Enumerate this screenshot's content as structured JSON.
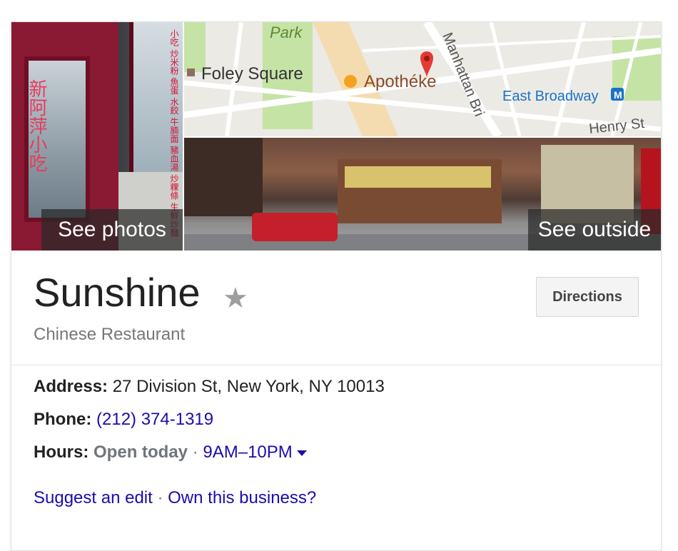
{
  "photo": {
    "overlay_label": "See photos",
    "sign_glyphs": "新阿萍小吃",
    "menu_glyphs": "小吃 炒米粉 魚蛋 水餃 牛腩面 豬血湯 炒粿條 生鮮炒麵"
  },
  "map": {
    "labels": {
      "park": "Park",
      "foley_square": "Foley Square",
      "place": "Apothéke",
      "manhattan_bridge": "Manhattan Bri",
      "east_broadway": "East Broadway",
      "henry_st": "Henry St",
      "subway_badge": "M"
    },
    "colors": {
      "park": "#c5e3a5",
      "road": "#ffffff",
      "highway": "#f5dcb0",
      "pin": "#e53935",
      "poi": "#8d6e63",
      "transit": "#1a73c8"
    }
  },
  "street": {
    "overlay_label": "See outside"
  },
  "business": {
    "name": "Sunshine",
    "category": "Chinese Restaurant",
    "directions_label": "Directions",
    "address_label": "Address:",
    "address_value": "27 Division St, New York, NY 10013",
    "phone_label": "Phone:",
    "phone_value": "(212) 374-1319",
    "hours_label": "Hours:",
    "hours_status": "Open today",
    "hours_sep": "·",
    "hours_value": "9AM–10PM",
    "suggest_edit": "Suggest an edit",
    "links_sep": "·",
    "own_business": "Own this business?"
  }
}
